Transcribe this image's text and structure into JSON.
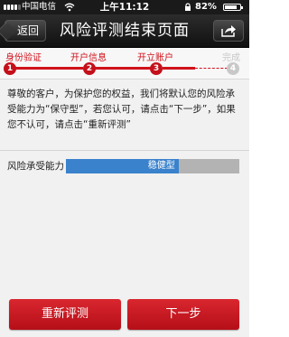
{
  "status_bar": {
    "carrier": "中国电信",
    "time": "上午11:12",
    "battery": "82%",
    "battery_level": 0.82
  },
  "nav": {
    "back_label": "返回",
    "title": "风险评测结束页面"
  },
  "steps": [
    {
      "label": "身份验证",
      "number": "1",
      "state": "done"
    },
    {
      "label": "开户信息",
      "number": "2",
      "state": "done"
    },
    {
      "label": "开立账户",
      "number": "3",
      "state": "current"
    },
    {
      "label": "完成",
      "number": "4",
      "state": "pending"
    }
  ],
  "content": {
    "message": "尊敬的客户，为保护您的权益，我们将默认您的风险承受能力为“保守型”，若您认可，请点击“下一步”，如果您不认可，请点击“重新评测”",
    "risk_label": "风险承受能力",
    "risk_value": "稳健型",
    "risk_level": 0.65
  },
  "buttons": {
    "retest": "重新评测",
    "next": "下一步"
  },
  "colors": {
    "accent": "#d0121b",
    "risk_fill": "#3a82cc",
    "risk_track": "#b3b3b3"
  }
}
